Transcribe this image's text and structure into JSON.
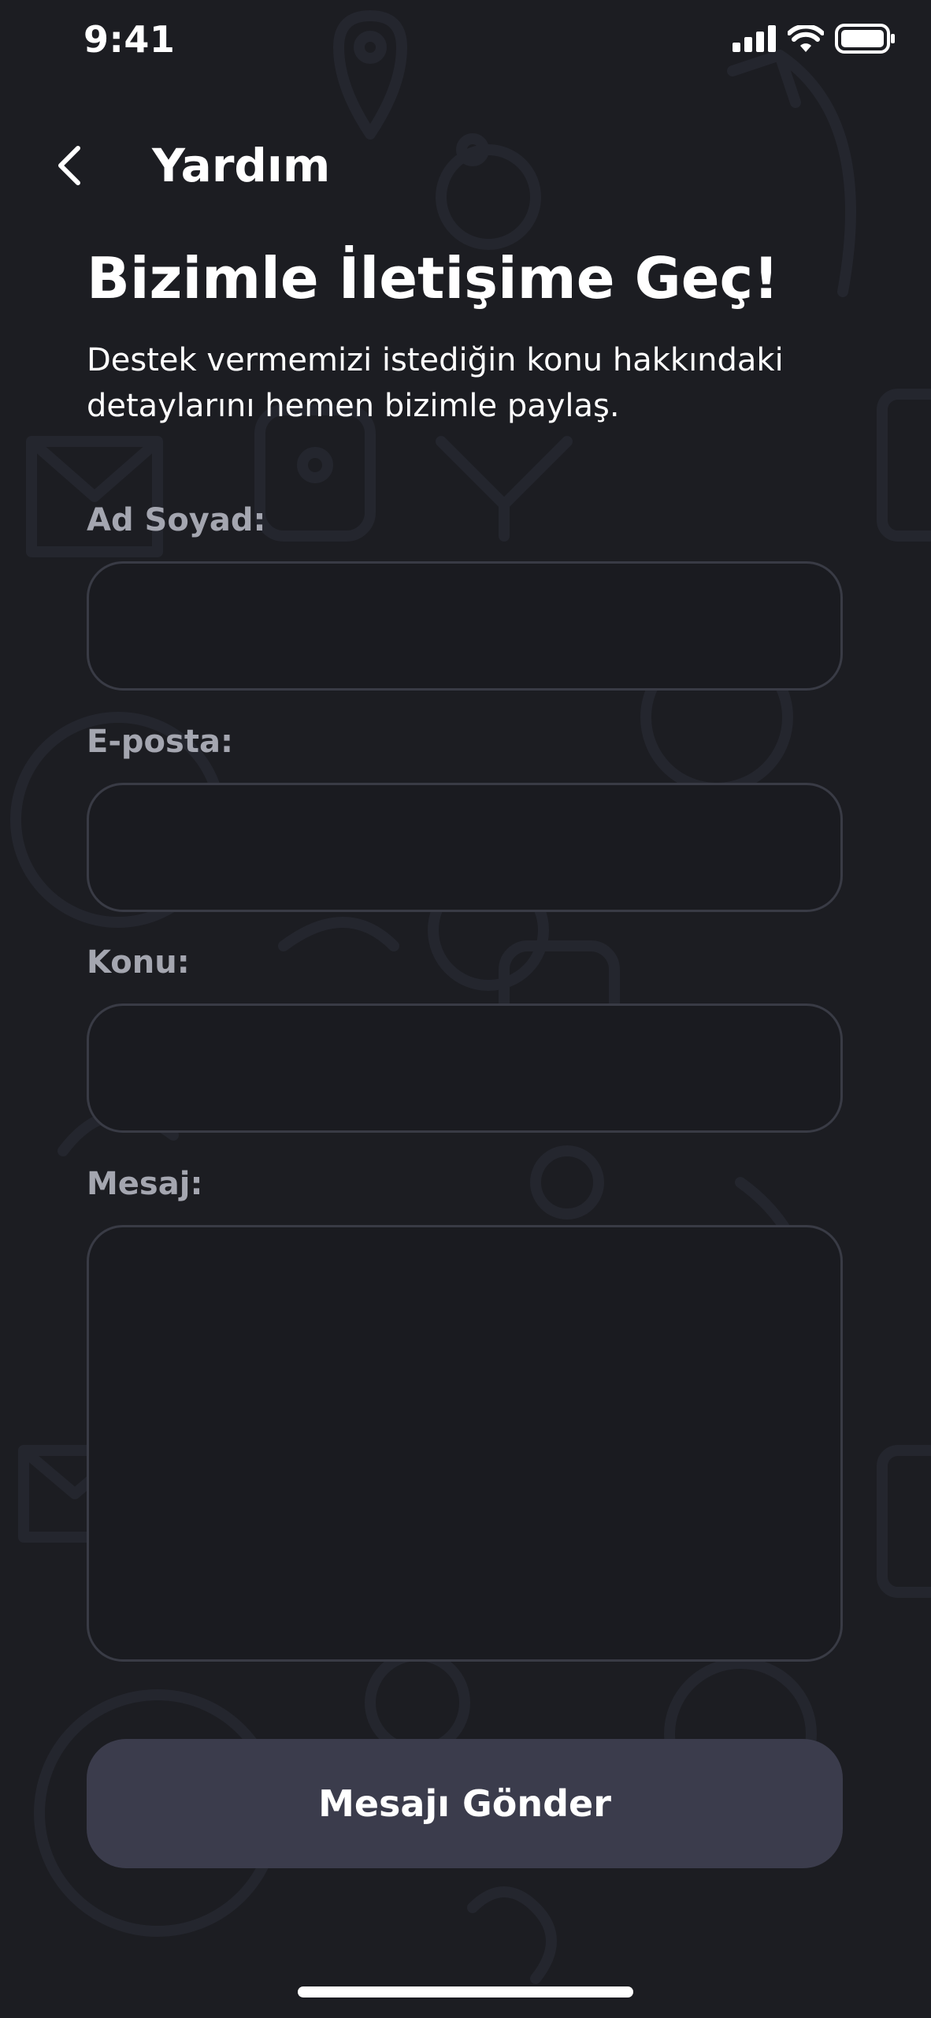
{
  "status_bar": {
    "time": "9:41",
    "signal_icon": "cellular-signal-icon",
    "wifi_icon": "wifi-icon",
    "battery_icon": "battery-icon"
  },
  "header": {
    "back_icon": "chevron-left-icon",
    "title": "Yardım"
  },
  "intro": {
    "title": "Bizimle İletişime Geç!",
    "subtitle": "Destek vermemizi istediğin konu hakkındaki detaylarını hemen bizimle paylaş."
  },
  "form": {
    "name_label": "Ad Soyad:",
    "name_value": "",
    "email_label": "E-posta:",
    "email_value": "",
    "subject_label": "Konu:",
    "subject_value": "",
    "message_label": "Mesaj:",
    "message_value": "",
    "submit_label": "Mesajı Gönder"
  },
  "colors": {
    "background": "#1c1d22",
    "label": "#a4a6b0",
    "field_border": "#393b45",
    "button": "#3b3c4c",
    "text": "#ffffff"
  }
}
